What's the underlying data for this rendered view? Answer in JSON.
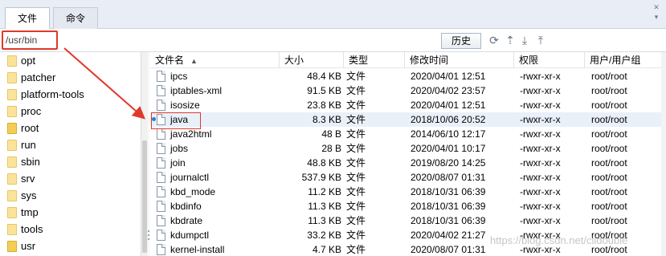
{
  "tabs": [
    {
      "label": "文件",
      "active": true
    },
    {
      "label": "命令",
      "active": false
    }
  ],
  "pathbar": {
    "path_value": "/usr/bin",
    "history_label": "历史",
    "icons": [
      "refresh-icon",
      "upload-up-icon",
      "download-icon",
      "upload-icon"
    ]
  },
  "tree": {
    "items": [
      {
        "label": "opt",
        "folder": "light"
      },
      {
        "label": "patcher",
        "folder": "light"
      },
      {
        "label": "platform-tools",
        "folder": "light"
      },
      {
        "label": "proc",
        "folder": "light"
      },
      {
        "label": "root",
        "folder": "dark"
      },
      {
        "label": "run",
        "folder": "light"
      },
      {
        "label": "sbin",
        "folder": "light"
      },
      {
        "label": "srv",
        "folder": "light"
      },
      {
        "label": "sys",
        "folder": "light"
      },
      {
        "label": "tmp",
        "folder": "light"
      },
      {
        "label": "tools",
        "folder": "light"
      },
      {
        "label": "usr",
        "folder": "dark"
      }
    ]
  },
  "filelist": {
    "headers": {
      "name": "文件名",
      "size": "大小",
      "type": "类型",
      "mtime": "修改时间",
      "perm": "权限",
      "owner": "用户/用户组"
    },
    "rows": [
      {
        "name": "ipcs",
        "size": "48.4 KB",
        "type": "文件",
        "mtime": "2020/04/01 12:51",
        "perm": "-rwxr-xr-x",
        "owner": "root/root"
      },
      {
        "name": "iptables-xml",
        "size": "91.5 KB",
        "type": "文件",
        "mtime": "2020/04/02 23:57",
        "perm": "-rwxr-xr-x",
        "owner": "root/root"
      },
      {
        "name": "isosize",
        "size": "23.8 KB",
        "type": "文件",
        "mtime": "2020/04/01 12:51",
        "perm": "-rwxr-xr-x",
        "owner": "root/root"
      },
      {
        "name": "java",
        "size": "8.3 KB",
        "type": "文件",
        "mtime": "2018/10/06 20:52",
        "perm": "-rwxr-xr-x",
        "owner": "root/root",
        "selected": true
      },
      {
        "name": "java2html",
        "size": "48 B",
        "type": "文件",
        "mtime": "2014/06/10 12:17",
        "perm": "-rwxr-xr-x",
        "owner": "root/root"
      },
      {
        "name": "jobs",
        "size": "28 B",
        "type": "文件",
        "mtime": "2020/04/01 10:17",
        "perm": "-rwxr-xr-x",
        "owner": "root/root"
      },
      {
        "name": "join",
        "size": "48.8 KB",
        "type": "文件",
        "mtime": "2019/08/20 14:25",
        "perm": "-rwxr-xr-x",
        "owner": "root/root"
      },
      {
        "name": "journalctl",
        "size": "537.9 KB",
        "type": "文件",
        "mtime": "2020/08/07 01:31",
        "perm": "-rwxr-xr-x",
        "owner": "root/root"
      },
      {
        "name": "kbd_mode",
        "size": "11.2 KB",
        "type": "文件",
        "mtime": "2018/10/31 06:39",
        "perm": "-rwxr-xr-x",
        "owner": "root/root"
      },
      {
        "name": "kbdinfo",
        "size": "11.3 KB",
        "type": "文件",
        "mtime": "2018/10/31 06:39",
        "perm": "-rwxr-xr-x",
        "owner": "root/root"
      },
      {
        "name": "kbdrate",
        "size": "11.3 KB",
        "type": "文件",
        "mtime": "2018/10/31 06:39",
        "perm": "-rwxr-xr-x",
        "owner": "root/root"
      },
      {
        "name": "kdumpctl",
        "size": "33.2 KB",
        "type": "文件",
        "mtime": "2020/04/02 21:27",
        "perm": "-rwxr-xr-x",
        "owner": "root/root"
      },
      {
        "name": "kernel-install",
        "size": "4.7 KB",
        "type": "文件",
        "mtime": "2020/08/07 01:31",
        "perm": "-rwxr-xr-x",
        "owner": "root/root"
      }
    ]
  },
  "watermark": "https://blog.csdn.net/clldouble",
  "colors": {
    "annotation_red": "#e0392b",
    "selected_row": "#e8f0fa",
    "folder": "#fbe39a"
  }
}
